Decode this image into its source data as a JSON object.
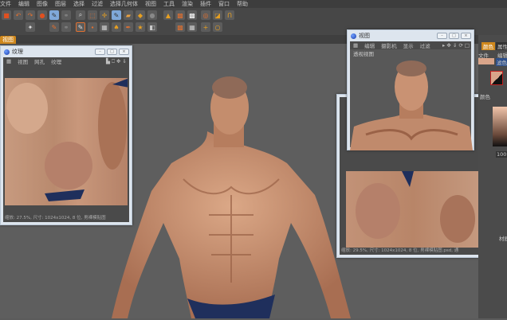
{
  "menu": [
    "文件",
    "编辑",
    "图像",
    "图层",
    "选择",
    "过滤",
    "选择几何体",
    "视图",
    "工具",
    "渲染",
    "插件",
    "窗口",
    "帮助"
  ],
  "tab_label": "视图",
  "texture_window": {
    "title": "纹理",
    "menu": [
      "视图",
      "网孔",
      "纹理"
    ],
    "status": "缩放: 27.5%, 尺寸: 1024x1024, 8 位, 男裸模贴图"
  },
  "texture_window2": {
    "status": "缩放: 29.5%, 尺寸: 1024x1024, 8 位, 男裸模贴图.psd, 通"
  },
  "view_window": {
    "title": "视图",
    "menu": [
      "编辑",
      "摄影机",
      "显示",
      "过滤"
    ],
    "view_label": "透视视图"
  },
  "right_panel": {
    "tab_color": "颜色",
    "tab_attr": "属性",
    "file": "文件",
    "edit": "编辑",
    "mode": "滤色",
    "color_label": "颜色",
    "value": "100",
    "material": "材质"
  },
  "colors": {
    "accent": "#d0881c",
    "skin": "#c8906e",
    "shorts": "#1f2f5c"
  }
}
